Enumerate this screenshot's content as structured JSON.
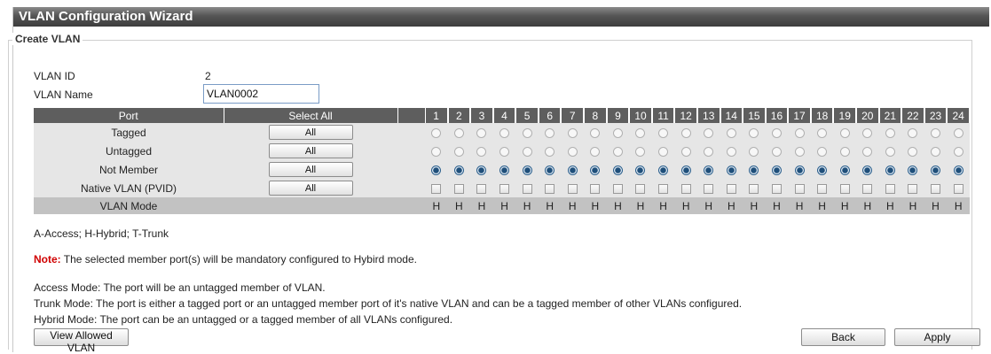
{
  "window": {
    "title": "VLAN Configuration Wizard"
  },
  "section": {
    "legend": "Create VLAN"
  },
  "form": {
    "vlan_id_label": "VLAN ID",
    "vlan_id_value": "2",
    "vlan_name_label": "VLAN Name",
    "vlan_name_value": "VLAN0002"
  },
  "table": {
    "port_header": "Port",
    "select_all_header": "Select All",
    "ports": [
      "1",
      "2",
      "3",
      "4",
      "5",
      "6",
      "7",
      "8",
      "9",
      "10",
      "11",
      "12",
      "13",
      "14",
      "15",
      "16",
      "17",
      "18",
      "19",
      "20",
      "21",
      "22",
      "23",
      "24"
    ],
    "rows": [
      {
        "label": "Tagged",
        "button": "All",
        "control": "radio",
        "checked": false
      },
      {
        "label": "Untagged",
        "button": "All",
        "control": "radio",
        "checked": false
      },
      {
        "label": "Not Member",
        "button": "All",
        "control": "radio",
        "checked": true
      },
      {
        "label": "Native VLAN (PVID)",
        "button": "All",
        "control": "checkbox",
        "checked": false
      }
    ],
    "mode_label": "VLAN Mode",
    "mode_values": [
      "H",
      "H",
      "H",
      "H",
      "H",
      "H",
      "H",
      "H",
      "H",
      "H",
      "H",
      "H",
      "H",
      "H",
      "H",
      "H",
      "H",
      "H",
      "H",
      "H",
      "H",
      "H",
      "H",
      "H"
    ]
  },
  "legend_text": "A-Access; H-Hybrid; T-Trunk",
  "note": {
    "head": "Note:",
    "body": " The selected member port(s) will be mandatory configured to Hybird mode."
  },
  "descriptions": {
    "access": "Access Mode: The port will be an untagged member of VLAN.",
    "trunk": "Trunk Mode: The port is either a tagged port or an untagged member port of it's native VLAN and can be a tagged member of other VLANs configured.",
    "hybrid": "Hybrid Mode: The port can be an untagged or a tagged member of all VLANs configured."
  },
  "buttons": {
    "view_allowed": "View Allowed VLAN",
    "back": "Back",
    "apply": "Apply"
  }
}
